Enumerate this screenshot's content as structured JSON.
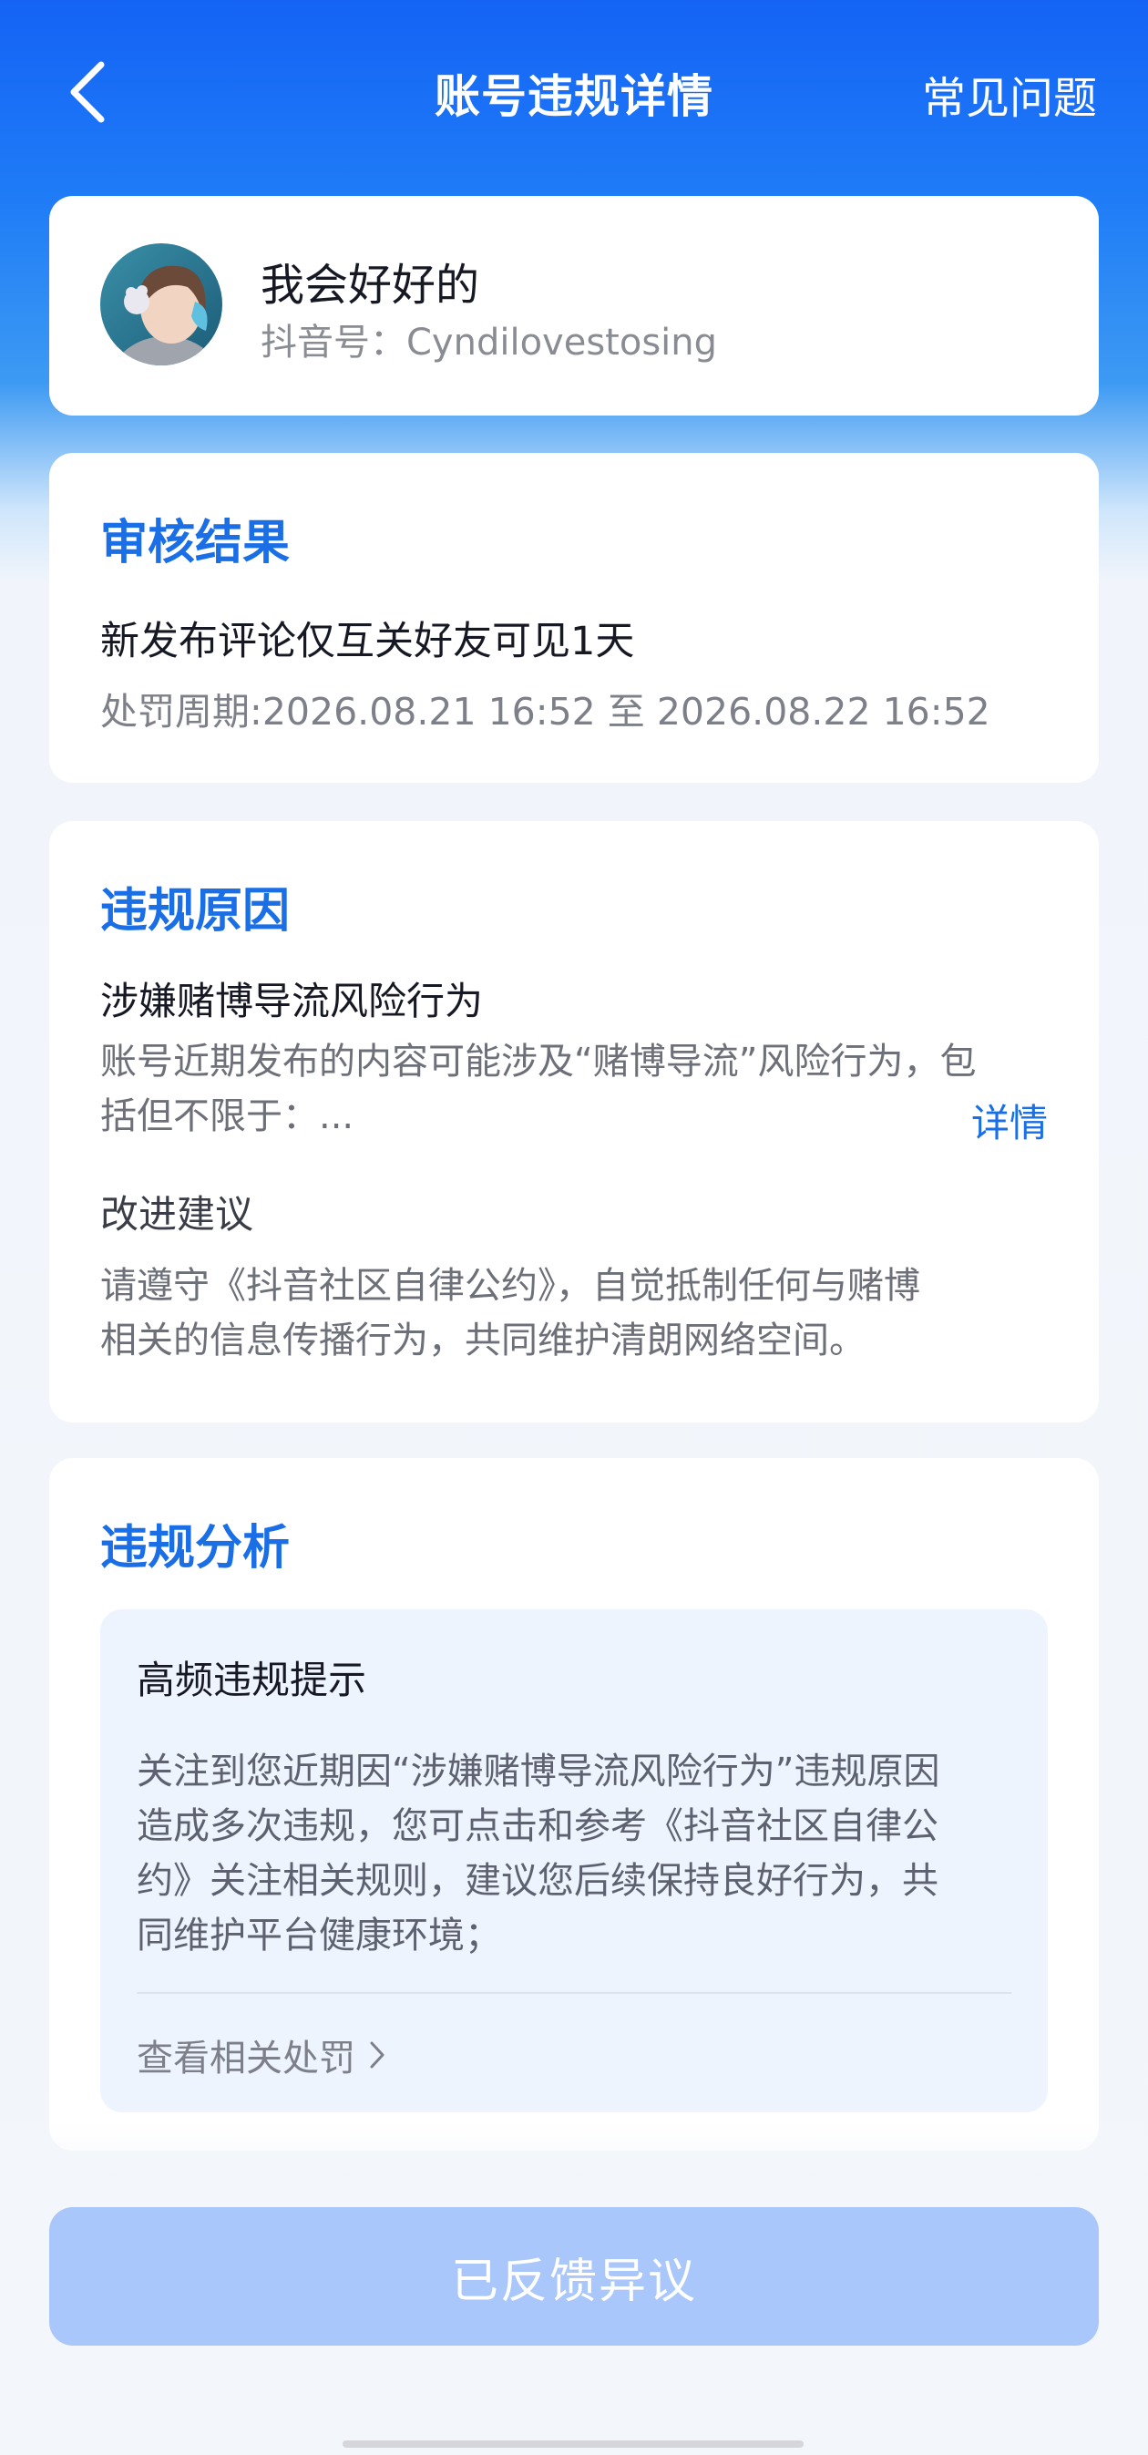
{
  "header": {
    "title": "账号违规详情",
    "faq_label": "常见问题"
  },
  "user": {
    "name": "我会好好的",
    "douyin_id": "抖音号：Cyndilovestosing"
  },
  "review_result": {
    "section_title": "审核结果",
    "penalty": "新发布评论仅互关好友可见1天",
    "period": "处罚周期:2026.08.21 16:52 至 2026.08.22 16:52"
  },
  "violation_reason": {
    "section_title": "违规原因",
    "reason_title": "涉嫌赌博导流风险行为",
    "description_line1": "账号近期发布的内容可能涉及“赌博导流”风险行为，包",
    "description_line2": "括但不限于：...",
    "detail_link": "详情",
    "advice_title": "改进建议",
    "advice_line1": "请遵守《抖音社区自律公约》，自觉抵制任何与赌博",
    "advice_line2": "相关的信息传播行为，共同维护清朗网络空间。"
  },
  "analysis": {
    "section_title": "违规分析",
    "tip_title": "高频违规提示",
    "tip_line1": "关注到您近期因“涉嫌赌博导流风险行为”违规原因",
    "tip_line2": "造成多次违规，您可点击和参考《抖音社区自律公",
    "tip_line3": "约》关注相关规则，建议您后续保持良好行为，共",
    "tip_line4": "同维护平台健康环境；",
    "view_penalties_link": "查看相关处罚"
  },
  "footer": {
    "button_label": "已反馈异议"
  },
  "colors": {
    "accent": "#1a6ee6",
    "header_blue": "#1463f5",
    "disabled_button": "#a9c7fb"
  },
  "icons": {
    "back": "chevron-left-icon",
    "view_more": "chevron-right-icon"
  }
}
